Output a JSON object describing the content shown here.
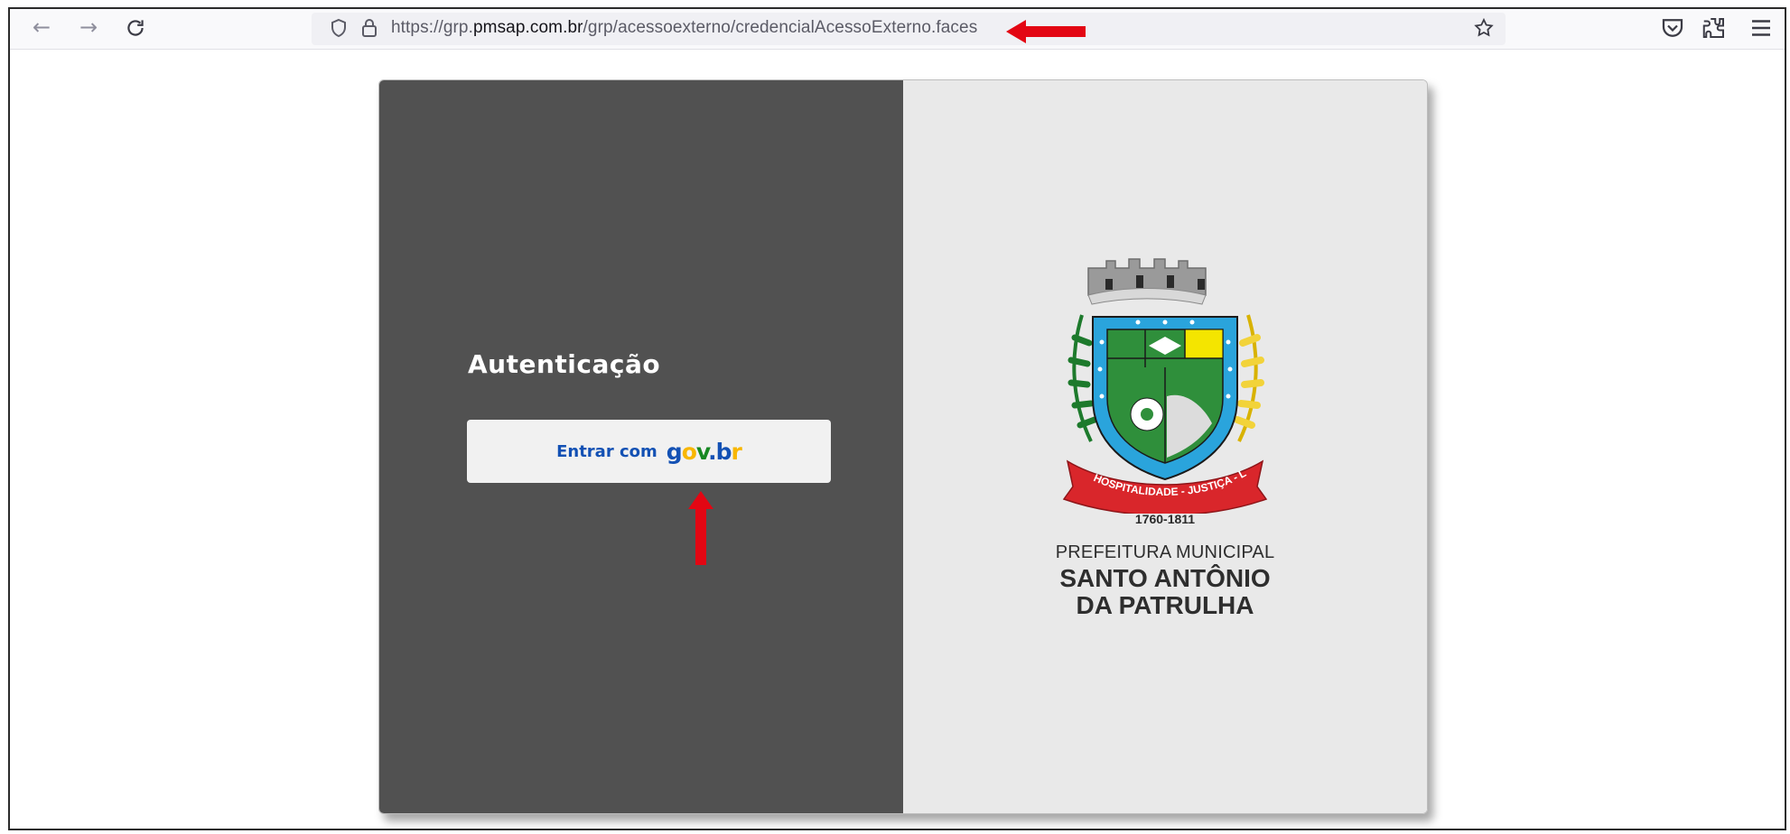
{
  "browser": {
    "url_prefix": "https://grp.",
    "url_host": "pmsap.com.br",
    "url_path": "/grp/acessoexterno/credencialAcessoExterno.faces",
    "icons": [
      "back-icon",
      "forward-icon",
      "reload-icon",
      "shield-icon",
      "lock-icon",
      "bookmark-star-icon",
      "pocket-icon",
      "extensions-icon",
      "menu-icon"
    ]
  },
  "login": {
    "title": "Autenticação",
    "button_prefix": "Entrar com",
    "govbr": {
      "g": "g",
      "o": "o",
      "v": "v",
      "dot": ".",
      "b": "b",
      "r": "r"
    }
  },
  "brand": {
    "motto": "HOSPITALIDADE - JUSTIÇA - LABOR",
    "years": "1760-1811",
    "line1": "PREFEITURA MUNICIPAL",
    "line2": "SANTO ANTÔNIO",
    "line3": "DA PATRULHA"
  },
  "colors": {
    "left_panel": "#515151",
    "right_panel": "#e9e9e9",
    "govbr_blue": "#1351b4",
    "govbr_yellow": "#f8b600",
    "govbr_green": "#168821",
    "annotation_red": "#e30613"
  }
}
